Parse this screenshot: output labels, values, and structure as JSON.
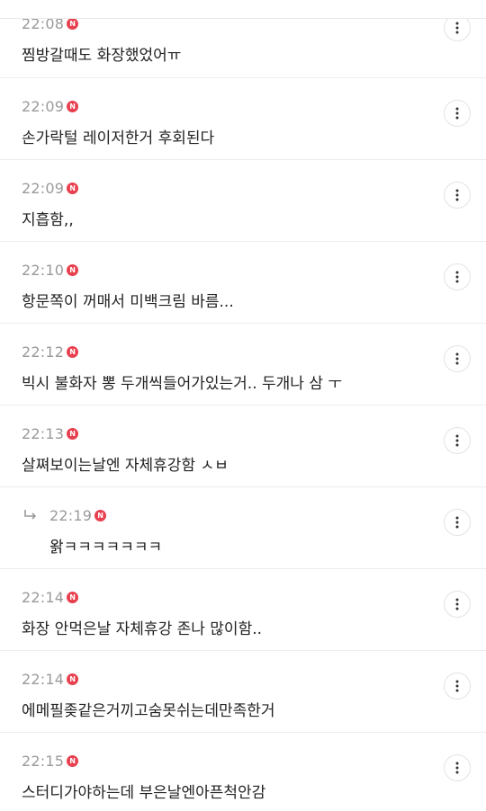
{
  "comments": [
    {
      "time": "22:08",
      "badge": "N",
      "text": "찜방갈때도 화장했었어ㅠ",
      "reply": false
    },
    {
      "time": "22:09",
      "badge": "N",
      "text": "손가락털 레이저한거 후회된다",
      "reply": false
    },
    {
      "time": "22:09",
      "badge": "N",
      "text": "지흡함,,",
      "reply": false
    },
    {
      "time": "22:10",
      "badge": "N",
      "text": "항문쪽이 꺼매서 미백크림 바름...",
      "reply": false
    },
    {
      "time": "22:12",
      "badge": "N",
      "text": "빅시 불화자 뽕 두개씩들어가있는거.. 두개나 삼 ㅜ",
      "reply": false
    },
    {
      "time": "22:13",
      "badge": "N",
      "text": "살쪄보이는날엔 자체휴강함 ㅅㅂ",
      "reply": false
    },
    {
      "time": "22:19",
      "badge": "N",
      "text": "왉ㅋㅋㅋㅋㅋㅋㅋ",
      "reply": true
    },
    {
      "time": "22:14",
      "badge": "N",
      "text": "화장 안먹은날 자체휴강 존나 많이함..",
      "reply": false
    },
    {
      "time": "22:14",
      "badge": "N",
      "text": "에메필좆같은거끼고숨못쉬는데만족한거",
      "reply": false
    },
    {
      "time": "22:15",
      "badge": "N",
      "text": "스터디가야하는데 부은날엔아픈척안감",
      "reply": false
    }
  ],
  "icons": {
    "reply": "reply-arrow-icon",
    "more": "more-vertical-icon",
    "new": "new-badge-icon"
  },
  "colors": {
    "badge": "#e8404f",
    "time": "#9a9a9a",
    "text": "#222222",
    "divider": "#ececec"
  }
}
